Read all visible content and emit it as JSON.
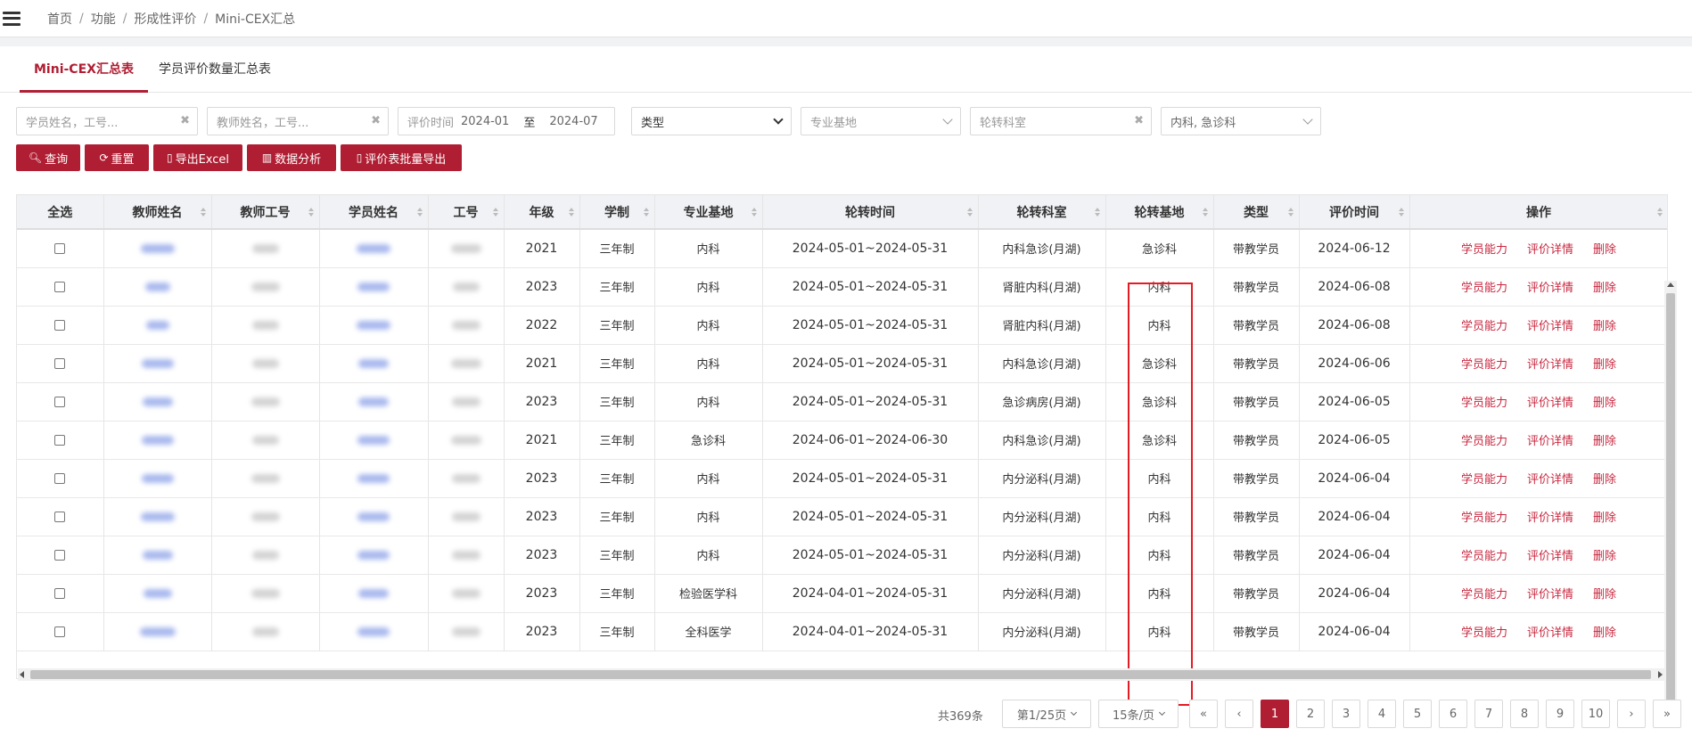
{
  "breadcrumb": [
    "首页",
    "功能",
    "形成性评价",
    "Mini-CEX汇总"
  ],
  "tabs": [
    {
      "label": "Mini-CEX汇总表",
      "active": true
    },
    {
      "label": "学员评价数量汇总表",
      "active": false
    }
  ],
  "filters": {
    "student_placeholder": "学员姓名，工号...",
    "teacher_placeholder": "教师姓名，工号...",
    "date_label": "评价时间",
    "date_from": "2024-01",
    "date_to_sep": "至",
    "date_to": "2024-07",
    "type_placeholder": "类型",
    "base_placeholder": "专业基地",
    "dept_placeholder": "轮转科室",
    "dept_base_value": "内科, 急诊科"
  },
  "buttons": {
    "query": "查询",
    "reset": "重置",
    "export_excel": "导出Excel",
    "analysis": "数据分析",
    "batch_export": "评价表批量导出"
  },
  "table": {
    "headers": [
      "全选",
      "教师姓名",
      "教师工号",
      "学员姓名",
      "工号",
      "年级",
      "学制",
      "专业基地",
      "轮转时间",
      "轮转科室",
      "轮转基地",
      "类型",
      "评价时间",
      "操作"
    ],
    "rows": [
      {
        "grade": "2021",
        "system": "三年制",
        "base": "内科",
        "period": "2024-05-01~2024-05-31",
        "dept": "内科急诊(月湖)",
        "rot_base": "急诊科",
        "type": "带教学员",
        "eval_time": "2024-06-12"
      },
      {
        "grade": "2023",
        "system": "三年制",
        "base": "内科",
        "period": "2024-05-01~2024-05-31",
        "dept": "肾脏内科(月湖)",
        "rot_base": "内科",
        "type": "带教学员",
        "eval_time": "2024-06-08"
      },
      {
        "grade": "2022",
        "system": "三年制",
        "base": "内科",
        "period": "2024-05-01~2024-05-31",
        "dept": "肾脏内科(月湖)",
        "rot_base": "内科",
        "type": "带教学员",
        "eval_time": "2024-06-08"
      },
      {
        "grade": "2021",
        "system": "三年制",
        "base": "内科",
        "period": "2024-05-01~2024-05-31",
        "dept": "内科急诊(月湖)",
        "rot_base": "急诊科",
        "type": "带教学员",
        "eval_time": "2024-06-06"
      },
      {
        "grade": "2023",
        "system": "三年制",
        "base": "内科",
        "period": "2024-05-01~2024-05-31",
        "dept": "急诊病房(月湖)",
        "rot_base": "急诊科",
        "type": "带教学员",
        "eval_time": "2024-06-05"
      },
      {
        "grade": "2021",
        "system": "三年制",
        "base": "急诊科",
        "period": "2024-06-01~2024-06-30",
        "dept": "内科急诊(月湖)",
        "rot_base": "急诊科",
        "type": "带教学员",
        "eval_time": "2024-06-05"
      },
      {
        "grade": "2023",
        "system": "三年制",
        "base": "内科",
        "period": "2024-05-01~2024-05-31",
        "dept": "内分泌科(月湖)",
        "rot_base": "内科",
        "type": "带教学员",
        "eval_time": "2024-06-04"
      },
      {
        "grade": "2023",
        "system": "三年制",
        "base": "内科",
        "period": "2024-05-01~2024-05-31",
        "dept": "内分泌科(月湖)",
        "rot_base": "内科",
        "type": "带教学员",
        "eval_time": "2024-06-04"
      },
      {
        "grade": "2023",
        "system": "三年制",
        "base": "内科",
        "period": "2024-05-01~2024-05-31",
        "dept": "内分泌科(月湖)",
        "rot_base": "内科",
        "type": "带教学员",
        "eval_time": "2024-06-04"
      },
      {
        "grade": "2023",
        "system": "三年制",
        "base": "检验医学科",
        "period": "2024-04-01~2024-05-31",
        "dept": "内分泌科(月湖)",
        "rot_base": "内科",
        "type": "带教学员",
        "eval_time": "2024-06-04"
      },
      {
        "grade": "2023",
        "system": "三年制",
        "base": "全科医学",
        "period": "2024-04-01~2024-05-31",
        "dept": "内分泌科(月湖)",
        "rot_base": "内科",
        "type": "带教学员",
        "eval_time": "2024-06-04"
      }
    ],
    "actions": [
      "学员能力",
      "评价详情",
      "删除"
    ]
  },
  "pagination": {
    "total": "共369条",
    "page_info": "第1/25页",
    "page_size": "15条/页",
    "first": "«",
    "prev": "‹",
    "pages": [
      "1",
      "2",
      "3",
      "4",
      "5",
      "6",
      "7",
      "8",
      "9",
      "10"
    ],
    "current": "1",
    "next": "›",
    "last": "»"
  },
  "colors": {
    "accent": "#b01e33",
    "highlight_border": "#e51b24",
    "link": "#c8283f"
  }
}
